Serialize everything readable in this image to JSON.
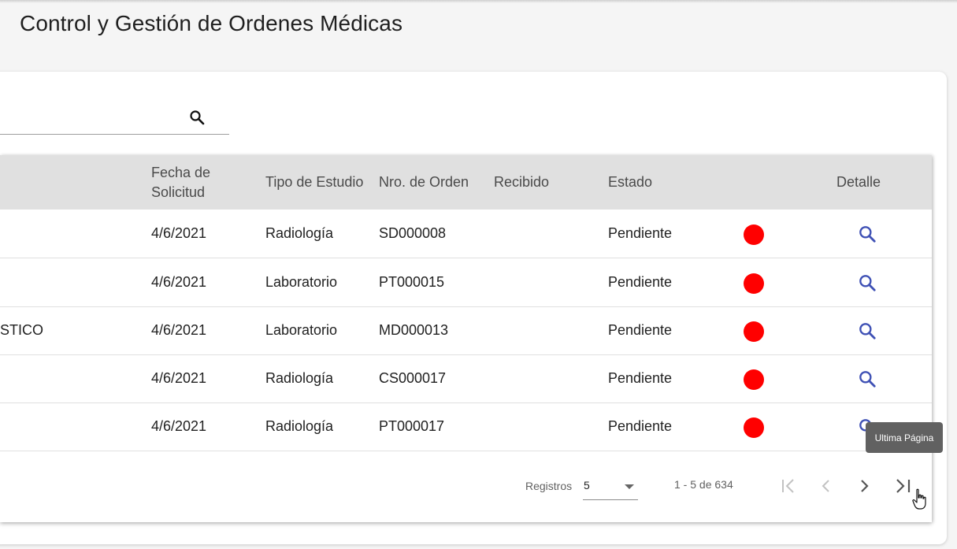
{
  "page": {
    "title": "Control y Gestión de Ordenes Médicas"
  },
  "search": {
    "value": "",
    "placeholder": "",
    "icon": "search-icon"
  },
  "table": {
    "headers": {
      "col0": "",
      "fecha": "Fecha de Solicitud",
      "tipo": "Tipo de Estudio",
      "nro": "Nro. de Orden",
      "recibido": "Recibido",
      "estado": "Estado",
      "detalle": "Detalle"
    },
    "rows": [
      {
        "col0": "",
        "fecha": "4/6/2021",
        "tipo": "Radiología",
        "nro": "SD000008",
        "recibido": "",
        "estado": "Pendiente"
      },
      {
        "col0": "",
        "fecha": "4/6/2021",
        "tipo": "Laboratorio",
        "nro": "PT000015",
        "recibido": "",
        "estado": "Pendiente"
      },
      {
        "col0": "STICO",
        "fecha": "4/6/2021",
        "tipo": "Laboratorio",
        "nro": "MD000013",
        "recibido": "",
        "estado": "Pendiente"
      },
      {
        "col0": "",
        "fecha": "4/6/2021",
        "tipo": "Radiología",
        "nro": "CS000017",
        "recibido": "",
        "estado": "Pendiente"
      },
      {
        "col0": "",
        "fecha": "4/6/2021",
        "tipo": "Radiología",
        "nro": "PT000017",
        "recibido": "",
        "estado": "Pendiente"
      }
    ],
    "status_color": "#ff0000",
    "detail_icon": "search-icon",
    "detail_icon_color": "#3f51b5"
  },
  "paginator": {
    "label": "Registros",
    "page_size": "5",
    "range": "1 - 5 de 634",
    "first_icon": "first-page-icon",
    "prev_icon": "chevron-left-icon",
    "next_icon": "chevron-right-icon",
    "last_icon": "last-page-icon"
  },
  "tooltip": {
    "text": "Ultima Página"
  }
}
